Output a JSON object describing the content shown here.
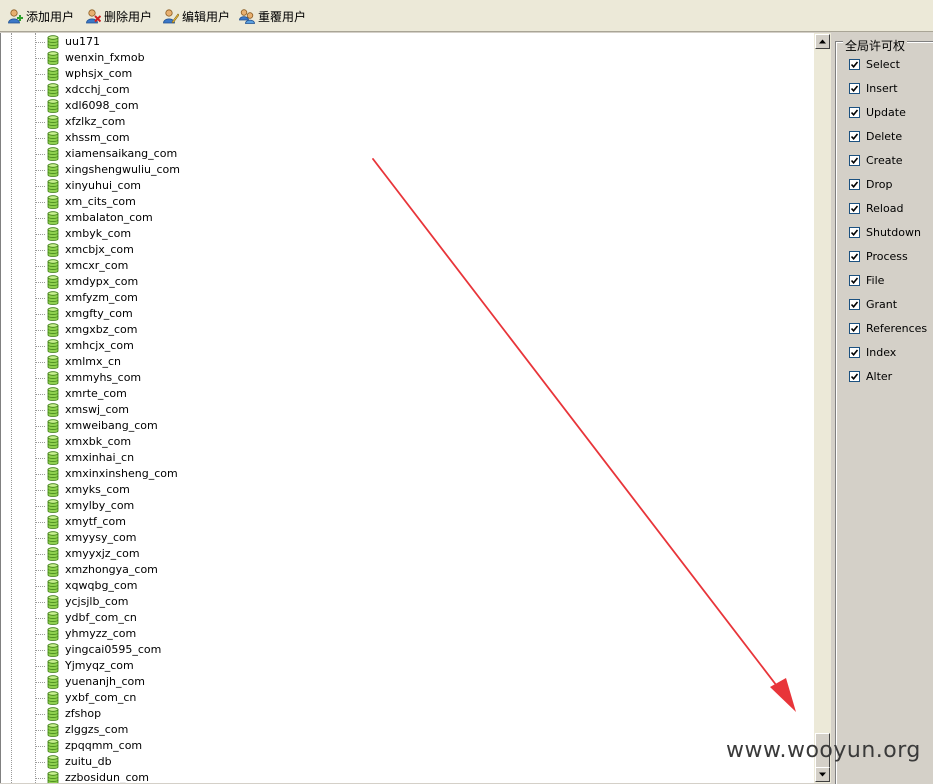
{
  "toolbar": {
    "buttons": [
      {
        "label": "添加用户",
        "icon": "add-user-icon"
      },
      {
        "label": "删除用户",
        "icon": "delete-user-icon"
      },
      {
        "label": "编辑用户",
        "icon": "edit-user-icon"
      },
      {
        "label": "重覆用户",
        "icon": "reset-user-icon"
      }
    ]
  },
  "tree": {
    "icon": "database-icon",
    "items": [
      "uu171",
      "wenxin_fxmob",
      "wphsjx_com",
      "xdcchj_com",
      "xdl6098_com",
      "xfzlkz_com",
      "xhssm_com",
      "xiamensaikang_com",
      "xingshengwuliu_com",
      "xinyuhui_com",
      "xm_cits_com",
      "xmbalaton_com",
      "xmbyk_com",
      "xmcbjx_com",
      "xmcxr_com",
      "xmdypx_com",
      "xmfyzm_com",
      "xmgfty_com",
      "xmgxbz_com",
      "xmhcjx_com",
      "xmlmx_cn",
      "xmmyhs_com",
      "xmrte_com",
      "xmswj_com",
      "xmweibang_com",
      "xmxbk_com",
      "xmxinhai_cn",
      "xmxinxinsheng_com",
      "xmyks_com",
      "xmylby_com",
      "xmytf_com",
      "xmyysy_com",
      "xmyyxjz_com",
      "xmzhongya_com",
      "xqwqbg_com",
      "ycjsjlb_com",
      "ydbf_com_cn",
      "yhmyzz_com",
      "yingcai0595_com",
      "Yjmyqz_com",
      "yuenanjh_com",
      "yxbf_com_cn",
      "zfshop",
      "zlggzs_com",
      "zpqqmm_com",
      "zuitu_db",
      "zzbosidun_com"
    ]
  },
  "privileges": {
    "title": "全局许可权",
    "items": [
      {
        "label": "Select",
        "checked": true
      },
      {
        "label": "Insert",
        "checked": true
      },
      {
        "label": "Update",
        "checked": true
      },
      {
        "label": "Delete",
        "checked": true
      },
      {
        "label": "Create",
        "checked": true
      },
      {
        "label": "Drop",
        "checked": true
      },
      {
        "label": "Reload",
        "checked": true
      },
      {
        "label": "Shutdown",
        "checked": true
      },
      {
        "label": "Process",
        "checked": true
      },
      {
        "label": "File",
        "checked": true
      },
      {
        "label": "Grant",
        "checked": true
      },
      {
        "label": "References",
        "checked": true
      },
      {
        "label": "Index",
        "checked": true
      },
      {
        "label": "Alter",
        "checked": true
      }
    ]
  },
  "annotation": {
    "color": "#e8353a"
  },
  "watermark": "www.wooyun.org"
}
